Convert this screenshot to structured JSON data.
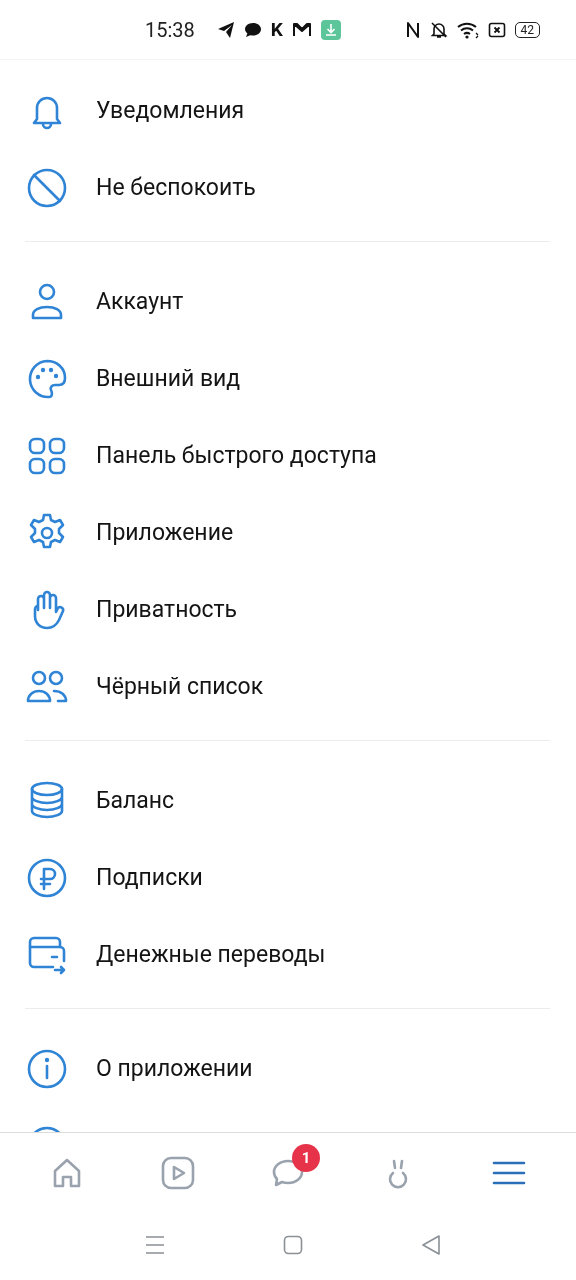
{
  "status_bar": {
    "time": "15:38",
    "notification_letter": "K",
    "battery": "42"
  },
  "sections": [
    {
      "items": [
        {
          "kind": "bell",
          "label": "Уведомления"
        },
        {
          "kind": "noentry",
          "label": "Не беспокоить"
        }
      ]
    },
    {
      "items": [
        {
          "kind": "person",
          "label": "Аккаунт"
        },
        {
          "kind": "palette",
          "label": "Внешний вид"
        },
        {
          "kind": "grid",
          "label": "Панель быстрого доступа"
        },
        {
          "kind": "gear",
          "label": "Приложение"
        },
        {
          "kind": "hand",
          "label": "Приватность"
        },
        {
          "kind": "people",
          "label": "Чёрный список"
        }
      ]
    },
    {
      "items": [
        {
          "kind": "coins",
          "label": "Баланс"
        },
        {
          "kind": "ruble",
          "label": "Подписки"
        },
        {
          "kind": "wallet",
          "label": "Денежные переводы"
        }
      ]
    },
    {
      "items": [
        {
          "kind": "info",
          "label": "О приложении"
        },
        {
          "kind": "circle"
        }
      ]
    }
  ],
  "tab_bar": [
    {
      "kind": "home",
      "selected": false
    },
    {
      "kind": "video",
      "selected": false
    },
    {
      "kind": "messages",
      "selected": false,
      "badge": "1"
    },
    {
      "kind": "clips",
      "selected": false
    },
    {
      "kind": "menu",
      "selected": true
    }
  ]
}
